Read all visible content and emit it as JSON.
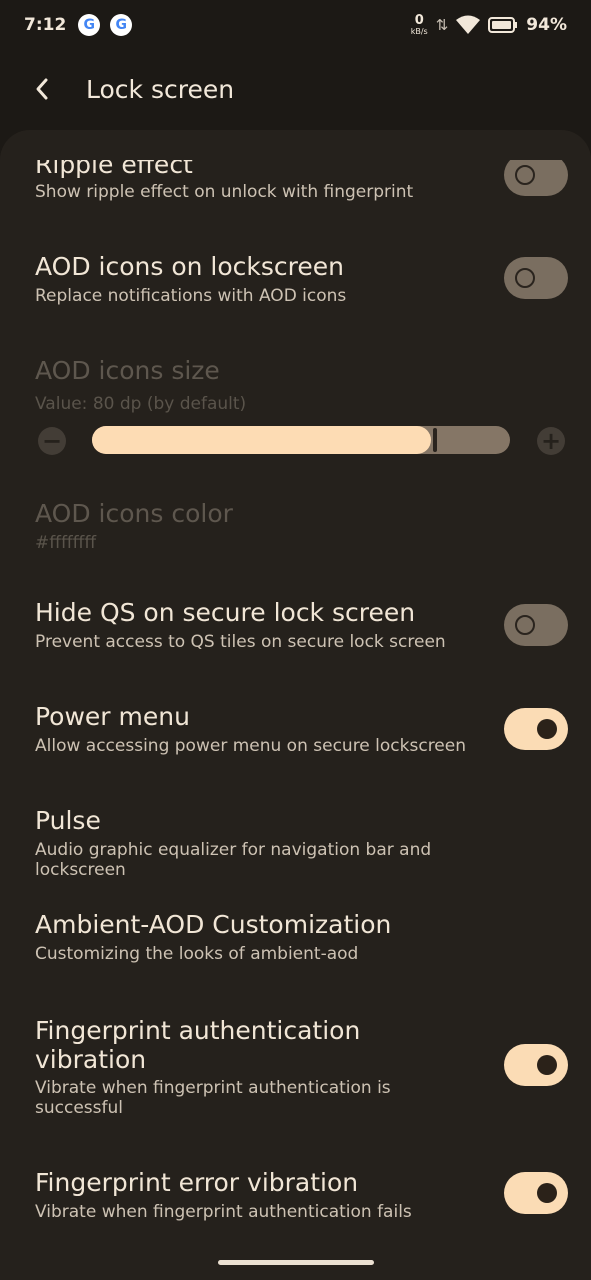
{
  "status_bar": {
    "time": "7:12",
    "net_speed_value": "0",
    "net_speed_unit": "kB/s",
    "battery": "94%"
  },
  "app_bar": {
    "title": "Lock screen"
  },
  "prefs": {
    "ripple": {
      "title": "Ripple effect",
      "summary": "Show ripple effect on unlock with fingerprint",
      "state": "off"
    },
    "aod_icons": {
      "title": "AOD icons on lockscreen",
      "summary": "Replace notifications with AOD icons",
      "state": "off"
    },
    "aod_size": {
      "title": "AOD icons size",
      "summary": "Value: 80 dp (by default)",
      "value_fraction": 0.81
    },
    "aod_color": {
      "title": "AOD icons color",
      "summary": "#ffffffff"
    },
    "hide_qs": {
      "title": "Hide QS on secure lock screen",
      "summary": "Prevent access to QS tiles on secure lock screen",
      "state": "off"
    },
    "power_menu": {
      "title": "Power menu",
      "summary": "Allow accessing power menu on secure lockscreen",
      "state": "on"
    },
    "pulse": {
      "title": "Pulse",
      "summary": "Audio graphic equalizer for navigation bar and lockscreen"
    },
    "ambient": {
      "title": "Ambient-AOD Customization",
      "summary": "Customizing the looks of ambient-aod"
    },
    "fp_auth": {
      "title": "Fingerprint authentication vibration",
      "summary": "Vibrate when fingerprint authentication is successful",
      "state": "on"
    },
    "fp_error": {
      "title": "Fingerprint error vibration",
      "summary": "Vibrate when fingerprint authentication fails",
      "state": "on"
    }
  },
  "colors": {
    "accent": "#fbdcb5",
    "background": "#1c1915",
    "surface": "#25211c"
  }
}
